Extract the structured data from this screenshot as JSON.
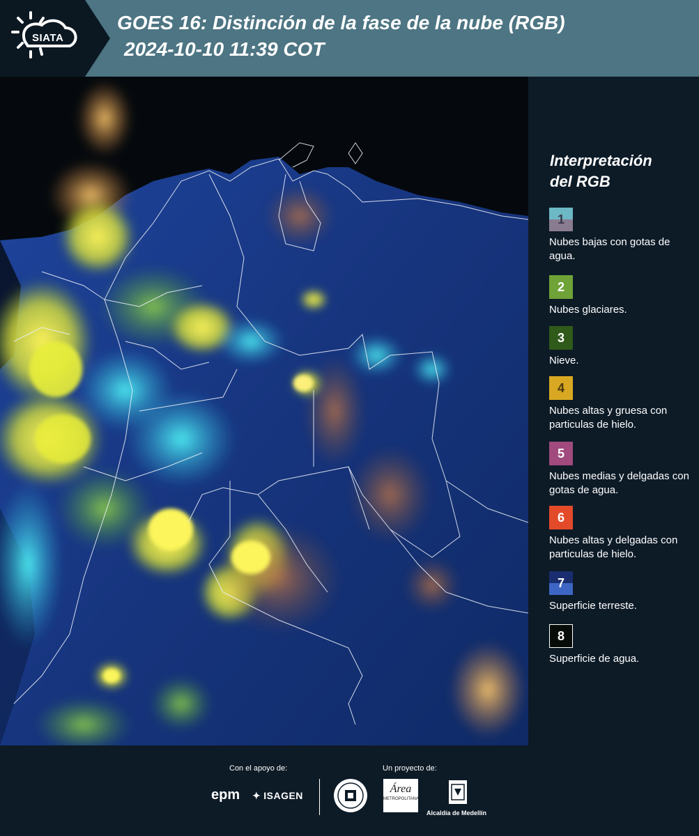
{
  "header": {
    "logo_text": "SIATA",
    "title": "GOES 16: Distinción de la fase de la nube (RGB)",
    "timestamp": "2024-10-10 11:39 COT"
  },
  "legend": {
    "title_line1": "Interpretación",
    "title_line2": "del RGB",
    "items": [
      {
        "number": "1",
        "label": "Nubes bajas con gotas de agua.",
        "color_top": "#6cb8c4",
        "color_bottom": "#8a7c90"
      },
      {
        "number": "2",
        "label": "Nubes glaciares.",
        "color": "#6fa337"
      },
      {
        "number": "3",
        "label": "Nieve.",
        "color": "#2f5a1a"
      },
      {
        "number": "4",
        "label": "Nubes altas y gruesa con particulas de hielo.",
        "color": "#d9a822"
      },
      {
        "number": "5",
        "label": "Nubes medias y delgadas con gotas de agua.",
        "color": "#a04a7e"
      },
      {
        "number": "6",
        "label": "Nubes altas y delgadas con particulas de hielo.",
        "color": "#e34a2a"
      },
      {
        "number": "7",
        "label": "Superficie terreste.",
        "color_top": "#1a2d6e",
        "color_bottom": "#3d66c4"
      },
      {
        "number": "8",
        "label": "Superficie de agua.",
        "color": "#080c08"
      }
    ]
  },
  "footer": {
    "support_caption": "Con el apoyo de:",
    "project_caption": "Un proyecto de:",
    "epm": "epm",
    "isagen": "ISAGEN",
    "area_logo": "Área",
    "area_sub": "METROPOLITANA",
    "alcaldia": "Alcaldía de Medellín"
  },
  "colors": {
    "header_band": "#4d7583",
    "background": "#0d1b27",
    "land_surface": "#1a3b8a",
    "water_surface": "#05090d"
  }
}
